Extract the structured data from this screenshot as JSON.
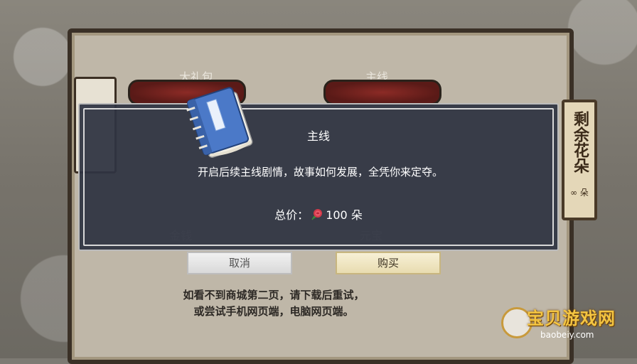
{
  "background": {
    "shop_items": [
      {
        "label": "大礼包"
      },
      {
        "label": "主线"
      },
      {
        "label": "金钱"
      },
      {
        "label": "元宝"
      }
    ],
    "right_tab": "剩余花朵",
    "remaining": "∞ 朵",
    "notice_line1": "如看不到商城第二页，请下载后重试，",
    "notice_line2": "或尝试手机网页端，电脑网页端。"
  },
  "dialog": {
    "title": "主线",
    "description": "开启后续主线剧情，故事如何发展，全凭你来定夺。",
    "price_label": "总价：",
    "price_value": "100 朵",
    "price_icon": "rose-icon",
    "book_icon": "book-icon"
  },
  "buttons": {
    "cancel": "取消",
    "buy": "购买"
  },
  "watermark": {
    "title": "宝贝游戏网",
    "url": "baobeiy.com"
  },
  "colors": {
    "dialog_bg": "#30344a",
    "book_blue": "#4b79c8",
    "rose_red": "#d33a4a",
    "watermark_gold": "#f4c542"
  }
}
